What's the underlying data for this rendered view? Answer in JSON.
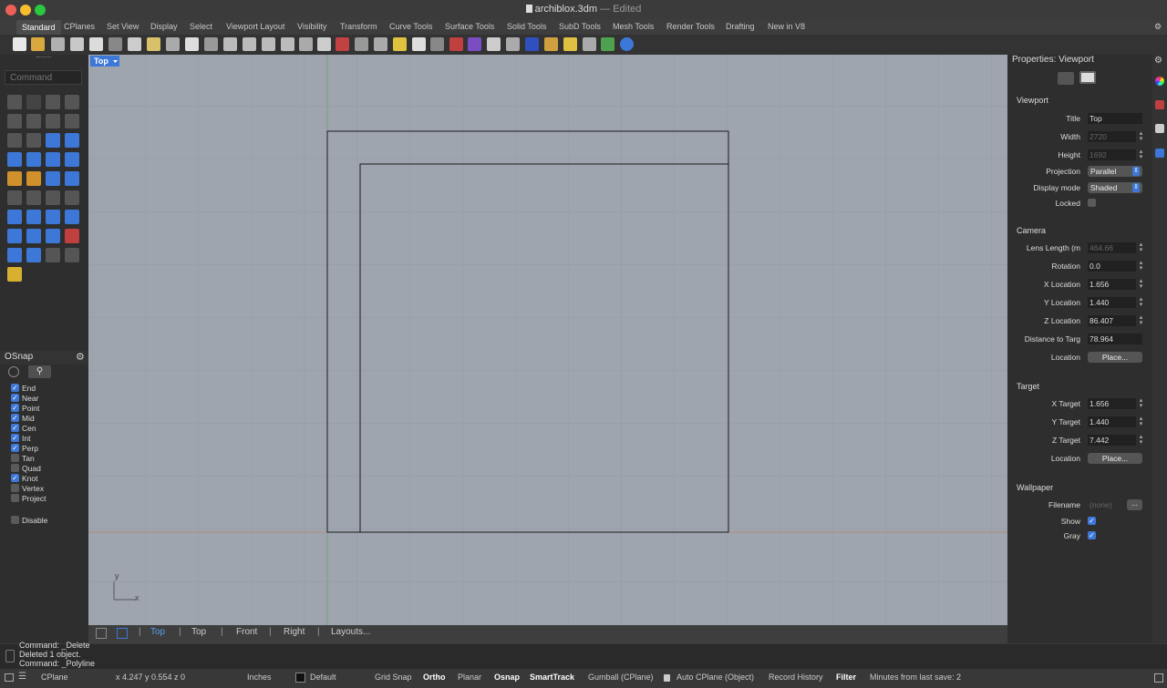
{
  "window": {
    "filename": "archiblox.3dm",
    "separator": "—",
    "status": "Edited"
  },
  "menu_tabs": [
    "Standard",
    "CPlanes",
    "Set View",
    "Display",
    "Select",
    "Viewport Layout",
    "Visibility",
    "Transform",
    "Curve Tools",
    "Surface Tools",
    "Solid Tools",
    "SubD Tools",
    "Mesh Tools",
    "Render Tools",
    "Drafting",
    "New in V8"
  ],
  "command": {
    "placeholder": "Command"
  },
  "osnap": {
    "title": "OSnap",
    "items": [
      {
        "label": "End",
        "checked": true
      },
      {
        "label": "Near",
        "checked": true
      },
      {
        "label": "Point",
        "checked": true
      },
      {
        "label": "Mid",
        "checked": true
      },
      {
        "label": "Cen",
        "checked": true
      },
      {
        "label": "Int",
        "checked": true
      },
      {
        "label": "Perp",
        "checked": true
      },
      {
        "label": "Tan",
        "checked": false
      },
      {
        "label": "Quad",
        "checked": false
      },
      {
        "label": "Knot",
        "checked": true
      },
      {
        "label": "Vertex",
        "checked": false
      },
      {
        "label": "Project",
        "checked": false
      }
    ],
    "disable": {
      "label": "Disable",
      "checked": false
    }
  },
  "viewport": {
    "name": "Top",
    "axis_y": "y",
    "axis_x": "x"
  },
  "viewport_tabs": [
    "Top",
    "Top",
    "Front",
    "Right",
    "Layouts..."
  ],
  "properties": {
    "title": "Properties: Viewport",
    "viewport_section": "Viewport",
    "title_label": "Title",
    "title_value": "Top",
    "width_label": "Width",
    "width_value": "2720",
    "height_label": "Height",
    "height_value": "1692",
    "projection_label": "Projection",
    "projection_value": "Parallel",
    "display_mode_label": "Display mode",
    "display_mode_value": "Shaded",
    "locked_label": "Locked",
    "camera_section": "Camera",
    "lens_label": "Lens Length (m",
    "lens_value": "464.66",
    "rotation_label": "Rotation",
    "rotation_value": "0.0",
    "xloc_label": "X Location",
    "xloc_value": "1.656",
    "yloc_label": "Y Location",
    "yloc_value": "1.440",
    "zloc_label": "Z Location",
    "zloc_value": "86.407",
    "dist_label": "Distance to Targ",
    "dist_value": "78.964",
    "location_label": "Location",
    "place_label": "Place...",
    "target_section": "Target",
    "xtgt_label": "X Target",
    "xtgt_value": "1.656",
    "ytgt_label": "Y Target",
    "ytgt_value": "1.440",
    "ztgt_label": "Z Target",
    "ztgt_value": "7.442",
    "tloc_label": "Location",
    "tplace_label": "Place...",
    "wallpaper_section": "Wallpaper",
    "filename_label": "Filename",
    "filename_value": "(none)",
    "browse_label": "...",
    "show_label": "Show",
    "gray_label": "Gray"
  },
  "history": [
    "Command: _Delete",
    "Deleted 1 object.",
    "Command: _Polyline"
  ],
  "status": {
    "cplane": "CPlane",
    "coords": "x 4.247  y 0.554  z 0",
    "units": "Inches",
    "layer": "Default",
    "grid_snap": "Grid Snap",
    "ortho": "Ortho",
    "planar": "Planar",
    "osnap": "Osnap",
    "smarttrack": "SmartTrack",
    "gumball": "Gumball (CPlane)",
    "auto_cplane": "Auto CPlane (Object)",
    "record_history": "Record History",
    "filter": "Filter",
    "last_save": "Minutes from last save: 2"
  },
  "colors": {
    "accent": "#3d78d8",
    "viewport_bg": "#9ea5af"
  }
}
